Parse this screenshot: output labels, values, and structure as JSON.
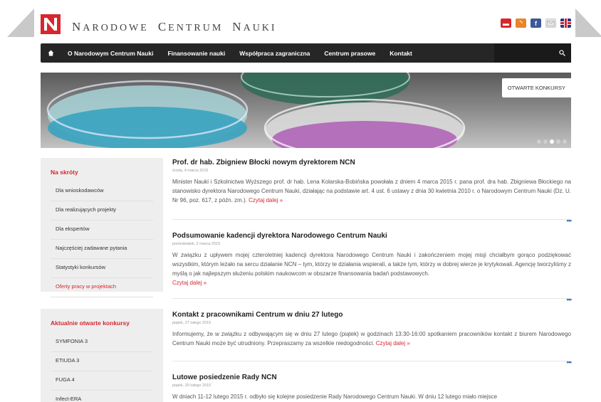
{
  "site": {
    "title": "Narodowe Centrum Nauki",
    "title_parts": [
      {
        "cap": "N",
        "rest": "ARODOWE"
      },
      {
        "cap": "C",
        "rest": "ENTRUM"
      },
      {
        "cap": "N",
        "rest": "AUKI"
      }
    ],
    "logo_icon": "ncn-logo-icon",
    "brand_color": "#d7262e"
  },
  "header_icons": [
    "bip-icon",
    "rss-icon",
    "facebook-icon",
    "mail-icon",
    "uk-flag-icon"
  ],
  "nav": {
    "home_icon": "home-icon",
    "items": [
      "O Narodowym Centrum Nauki",
      "Finansowanie nauki",
      "Współpraca zagraniczna",
      "Centrum prasowe",
      "Kontakt"
    ],
    "search_icon": "search-icon"
  },
  "slider": {
    "button_label": "OTWARTE KONKURSY",
    "dots_count": 5,
    "active_dot": 3
  },
  "sidebar": {
    "shortcuts": {
      "title": "Na skróty",
      "items": [
        "Dla wnioskodawców",
        "Dla realizujących projekty",
        "Dla ekspertów",
        "Najczęściej zadawane pytania",
        "Statystyki konkursów",
        "Oferty pracy w projektach"
      ]
    },
    "calls": {
      "title": "Aktualnie otwarte konkursy",
      "items": [
        "SYMFONIA 3",
        "ETIUDA 3",
        "FUGA 4",
        "Infect-ERA"
      ]
    }
  },
  "articles": [
    {
      "title": "Prof. dr hab. Zbigniew Błocki nowym dyrektorem NCN",
      "date": "środa, 4 marca 2015",
      "body": "Minister Nauki i Szkolnictwa Wyższego prof. dr hab. Lena Kolarska-Bobińska powołała z dniem 4 marca 2015 r. pana prof. dra hab. Zbigniewa Błockiego na stanowisko dyrektora Narodowego Centrum Nauki, działając na podstawie art. 4 ust. 6 ustawy z dnia 30 kwietnia 2010 r. o Narodowym Centrum Nauki (Dz. U. Nr 96, poz. 617, z późn. zm.). ",
      "more": "Czytaj dalej »"
    },
    {
      "title": "Podsumowanie kadencji dyrektora Narodowego Centrum Nauki",
      "date": "poniedziałek, 2 marca 2015",
      "body": "W związku z upływem mojej czteroletniej kadencji dyrektora Narodowego Centrum Nauki i zakończeniem mojej misji chciałbym gorąco podziękować wszystkim, którym leżało na sercu działanie NCN – tym, którzy te działania wspierali, a także tym, którzy w dobrej wierze je krytykowali. Agencję tworzyliśmy z myślą o jak najlepszym służeniu polskim naukowcom w obszarze finansowania badań podstawowych.",
      "more": "Czytaj dalej »"
    },
    {
      "title": "Kontakt z pracownikami Centrum w dniu 27 lutego",
      "date": "piątek, 27 lutego 2015",
      "body": "Informujemy, że w związku z odbywającym się w dniu 27 lutego (piątek) w godzinach 13:30-16:00 spotkaniem pracowników kontakt z biurem Narodowego Centrum Nauki może być utrudniony. Przepraszamy za wszelkie niedogodności. ",
      "more": "Czytaj dalej »"
    },
    {
      "title": "Lutowe posiedzenie Rady NCN",
      "date": "piątek, 20 lutego 2015",
      "body": "W dniach 11-12 lutego 2015 r. odbyło się kolejne posiedzenie Rady Narodowego Centrum Nauki. W dniu 12 lutego miało miejsce",
      "more": ""
    }
  ],
  "article_more_icon": "more-dots-icon",
  "article_more_glyph": "•••"
}
